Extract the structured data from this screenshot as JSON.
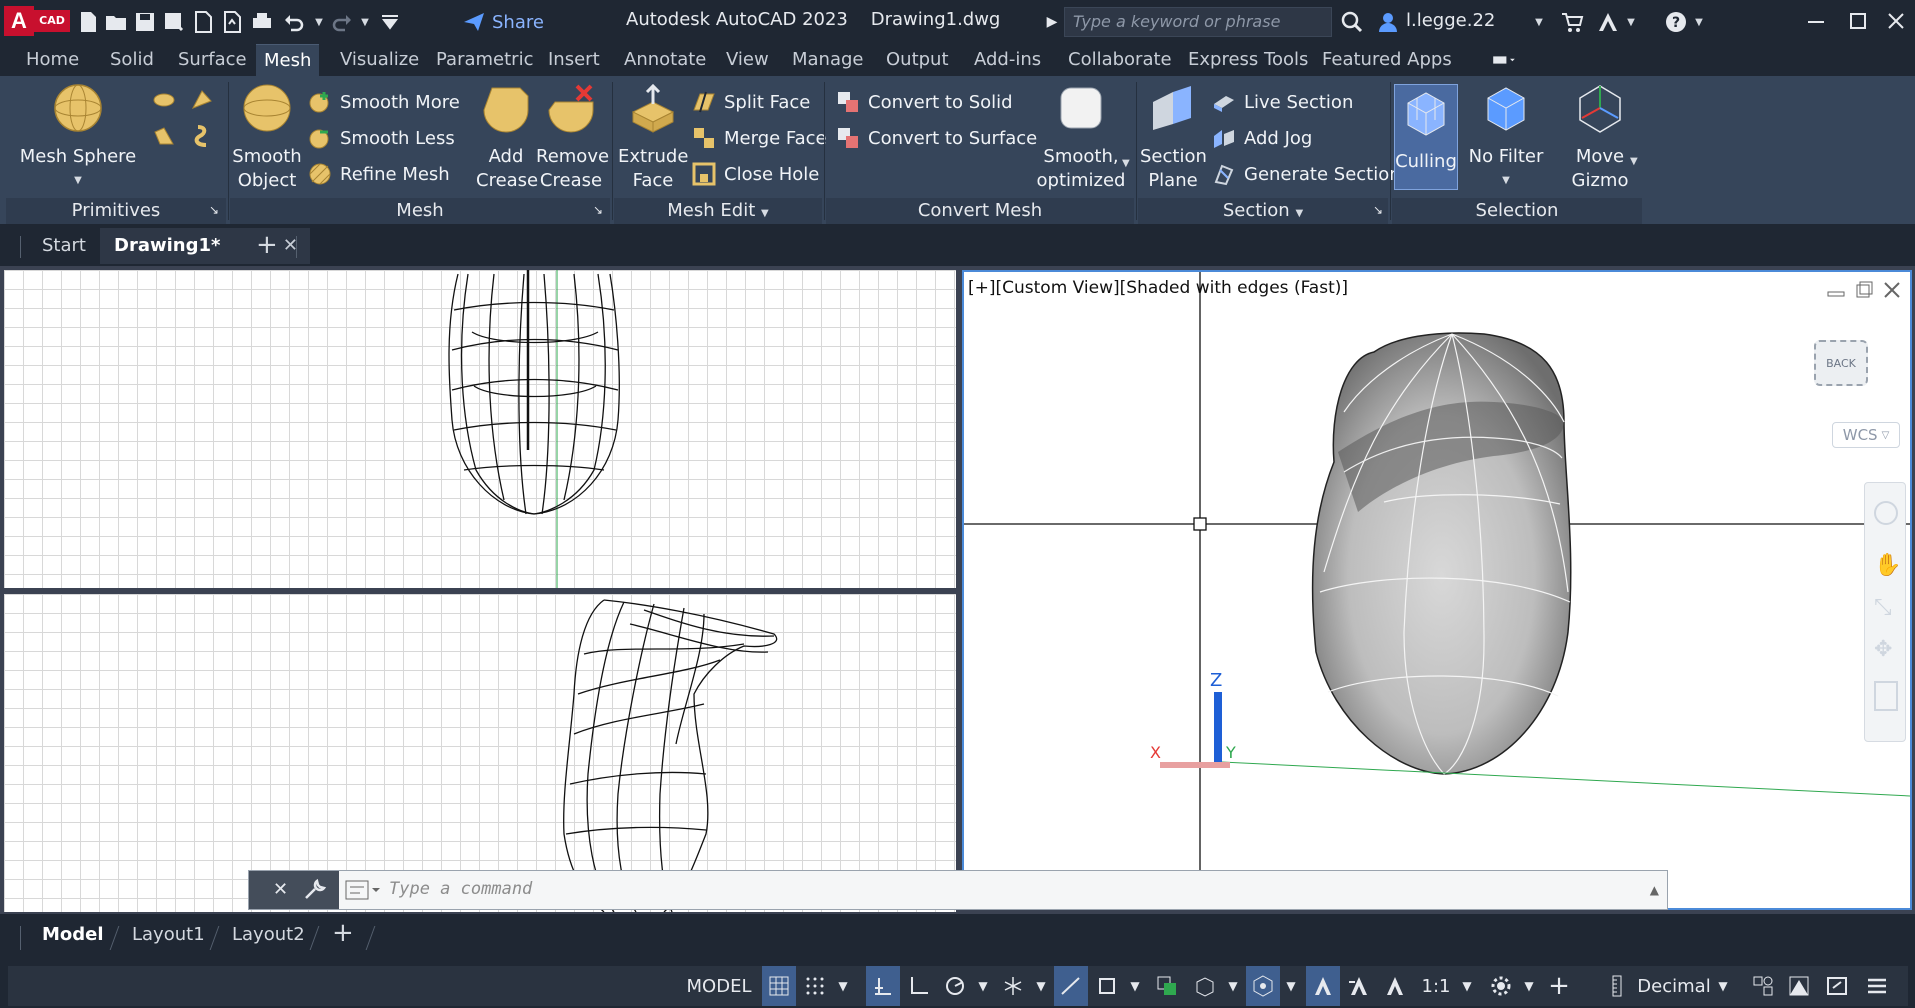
{
  "titlebar": {
    "logo_letter": "A",
    "logo_suffix": "CAD",
    "share_label": "Share",
    "title": "Autodesk AutoCAD 2023    Drawing1.dwg",
    "search_placeholder": "Type a keyword or phrase",
    "user": "l.legge.22"
  },
  "ribbon_tabs": [
    "Home",
    "Solid",
    "Surface",
    "Mesh",
    "Visualize",
    "Parametric",
    "Insert",
    "Annotate",
    "View",
    "Manage",
    "Output",
    "Add-ins",
    "Collaborate",
    "Express Tools",
    "Featured Apps"
  ],
  "active_tab": "Mesh",
  "ribbon": {
    "primitives": {
      "title": "Primitives",
      "mesh_sphere": "Mesh Sphere"
    },
    "mesh": {
      "title": "Mesh",
      "smooth_object": [
        "Smooth",
        "Object"
      ],
      "smooth_more": "Smooth More",
      "smooth_less": "Smooth Less",
      "refine_mesh": "Refine Mesh",
      "add_crease": [
        "Add",
        "Crease"
      ],
      "remove_crease": [
        "Remove",
        "Crease"
      ]
    },
    "mesh_edit": {
      "title": "Mesh Edit",
      "extrude_face": [
        "Extrude",
        "Face"
      ],
      "split_face": "Split Face",
      "merge_face": "Merge Face",
      "close_hole": "Close Hole"
    },
    "convert_mesh": {
      "title": "Convert Mesh",
      "to_solid": "Convert to Solid",
      "to_surface": "Convert to Surface",
      "smooth_optimized": [
        "Smooth,",
        "optimized"
      ]
    },
    "section": {
      "title": "Section",
      "section_plane": [
        "Section",
        "Plane"
      ],
      "live_section": "Live Section",
      "add_jog": "Add Jog",
      "generate_section": "Generate Section"
    },
    "selection": {
      "title": "Selection",
      "culling": "Culling",
      "no_filter": "No Filter",
      "move_gizmo": [
        "Move",
        "Gizmo"
      ]
    }
  },
  "doc_tabs": {
    "start": "Start",
    "drawing": "Drawing1*"
  },
  "viewport": {
    "label": "[+][Custom View][Shaded with edges (Fast)]",
    "viewcube": "BACK",
    "wcs": "WCS",
    "axis_z": "Z",
    "axis_y": "Y",
    "axis_x": "X"
  },
  "command": {
    "placeholder": "Type a command"
  },
  "layout_tabs": [
    "Model",
    "Layout1",
    "Layout2"
  ],
  "status": {
    "model": "MODEL",
    "scale": "1:1",
    "units": "Decimal"
  }
}
